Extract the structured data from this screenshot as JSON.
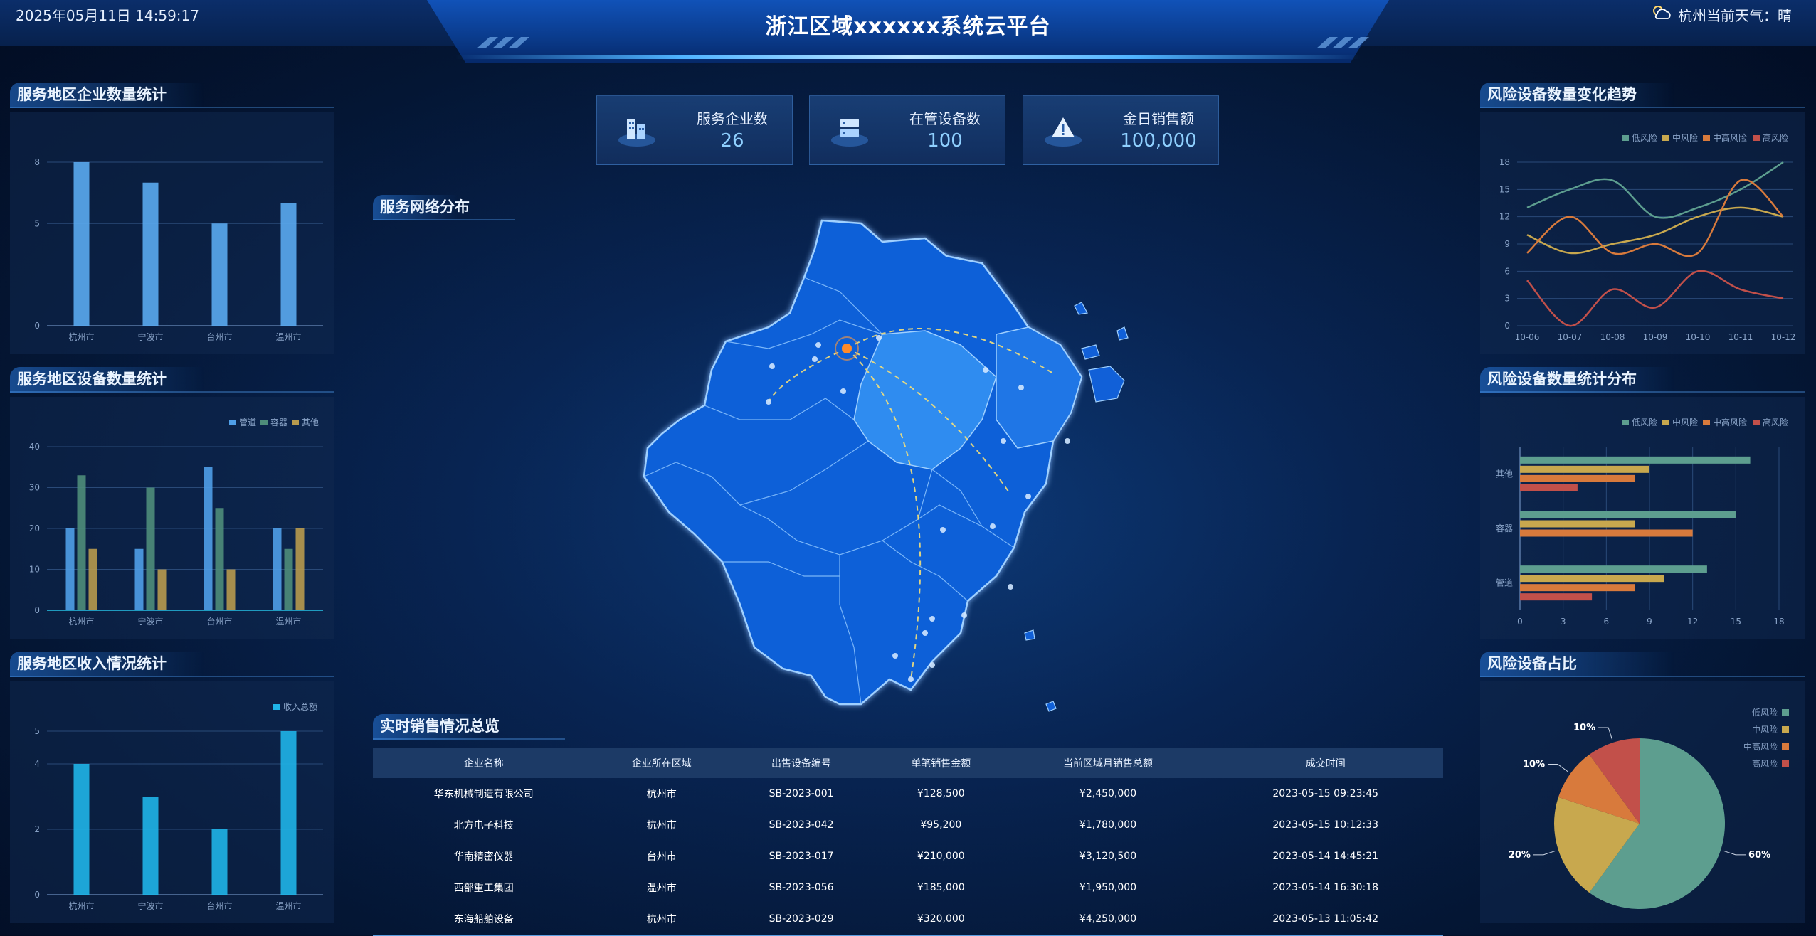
{
  "header": {
    "datetime": "2025年05月11日 14:59:17",
    "title": "浙江区域xxxxxx系统云平台",
    "weather": "杭州当前天气：晴",
    "weather_icon": "partly-cloudy-icon"
  },
  "stats": [
    {
      "label": "服务企业数",
      "value": "26",
      "icon": "enterprise-icon"
    },
    {
      "label": "在管设备数",
      "value": "100",
      "icon": "server-icon"
    },
    {
      "label": "金日销售额",
      "value": "100,000",
      "icon": "warning-icon"
    }
  ],
  "map": {
    "title": "服务网络分布"
  },
  "left": {
    "enterprise": {
      "title": "服务地区企业数量统计"
    },
    "devices": {
      "title": "服务地区设备数量统计"
    },
    "income": {
      "title": "服务地区收入情况统计"
    }
  },
  "right": {
    "trend": {
      "title": "风险设备数量变化趋势"
    },
    "dist": {
      "title": "风险设备数量统计分布"
    },
    "share": {
      "title": "风险设备占比"
    }
  },
  "sales": {
    "title": "实时销售情况总览",
    "columns": [
      "企业名称",
      "企业所在区域",
      "出售设备编号",
      "单笔销售金额",
      "当前区域月销售总额",
      "成交时间"
    ],
    "rows": [
      [
        "华东机械制造有限公司",
        "杭州市",
        "SB-2023-001",
        "¥128,500",
        "¥2,450,000",
        "2023-05-15 09:23:45"
      ],
      [
        "北方电子科技",
        "杭州市",
        "SB-2023-042",
        "¥95,200",
        "¥1,780,000",
        "2023-05-15 10:12:33"
      ],
      [
        "华南精密仪器",
        "台州市",
        "SB-2023-017",
        "¥210,000",
        "¥3,120,500",
        "2023-05-14 14:45:21"
      ],
      [
        "西部重工集团",
        "温州市",
        "SB-2023-056",
        "¥185,000",
        "¥1,950,000",
        "2023-05-14 16:30:18"
      ],
      [
        "东海船舶设备",
        "杭州市",
        "SB-2023-029",
        "¥320,000",
        "¥4,250,000",
        "2023-05-13 11:05:42"
      ]
    ]
  },
  "chart_data": [
    {
      "id": "enterprise",
      "type": "bar",
      "categories": [
        "杭州市",
        "宁波市",
        "台州市",
        "温州市"
      ],
      "values": [
        8,
        7,
        5,
        6
      ],
      "yticks": [
        "0",
        "5",
        "8"
      ],
      "ylim": [
        0,
        8
      ],
      "grid": true,
      "color": "#5aaaf0"
    },
    {
      "id": "devices",
      "type": "bar",
      "categories": [
        "杭州市",
        "宁波市",
        "台州市",
        "温州市"
      ],
      "series": [
        {
          "name": "管道",
          "values": [
            20,
            15,
            35,
            20
          ],
          "color": "#4f9fe8"
        },
        {
          "name": "容器",
          "values": [
            33,
            30,
            25,
            15
          ],
          "color": "#4e8d7a"
        },
        {
          "name": "其他",
          "values": [
            15,
            10,
            10,
            20
          ],
          "color": "#b79a4e"
        }
      ],
      "yticks": [
        "0",
        "10",
        "20",
        "30",
        "40"
      ],
      "ylim": [
        0,
        40
      ],
      "legend": "top-right",
      "grid": true
    },
    {
      "id": "income",
      "type": "bar",
      "categories": [
        "杭州市",
        "宁波市",
        "台州市",
        "温州市"
      ],
      "series": [
        {
          "name": "收入总额",
          "values": [
            4,
            3,
            2,
            5
          ],
          "color": "#1fb4e8"
        }
      ],
      "yticks": [
        "0",
        "2",
        "4",
        "5"
      ],
      "ylim": [
        0,
        5
      ],
      "legend": "top-right",
      "grid": true
    },
    {
      "id": "trend",
      "type": "line",
      "categories": [
        "10-06",
        "10-07",
        "10-08",
        "10-09",
        "10-10",
        "10-11",
        "10-12"
      ],
      "series": [
        {
          "name": "低风险",
          "values": [
            13,
            15,
            16,
            12,
            13,
            15,
            18
          ],
          "color": "#5d9e8f"
        },
        {
          "name": "中风险",
          "values": [
            10,
            8,
            9,
            10,
            12,
            13,
            12
          ],
          "color": "#c8a84e"
        },
        {
          "name": "中高风险",
          "values": [
            8,
            12,
            8,
            9,
            8,
            16,
            12
          ],
          "color": "#d87a3c"
        },
        {
          "name": "高风险",
          "values": [
            5,
            0,
            4,
            2,
            6,
            4,
            3
          ],
          "color": "#c2504a"
        }
      ],
      "yticks": [
        "0",
        "3",
        "6",
        "9",
        "12",
        "15",
        "18"
      ],
      "ylim": [
        0,
        18
      ],
      "legend": "top",
      "grid": true
    },
    {
      "id": "dist",
      "type": "bar",
      "orientation": "horizontal",
      "categories": [
        "管道",
        "容器",
        "其他"
      ],
      "series": [
        {
          "name": "低风险",
          "values": [
            13,
            15,
            16
          ],
          "color": "#5d9e8f"
        },
        {
          "name": "中风险",
          "values": [
            10,
            8,
            9
          ],
          "color": "#c8a84e"
        },
        {
          "name": "中高风险",
          "values": [
            8,
            12,
            8
          ],
          "color": "#d87a3c"
        },
        {
          "name": "高风险",
          "values": [
            5,
            0,
            4
          ],
          "color": "#c2504a"
        }
      ],
      "xticks": [
        "0",
        "3",
        "6",
        "9",
        "12",
        "15",
        "18"
      ],
      "xlim": [
        0,
        18
      ],
      "legend": "top",
      "grid": true
    },
    {
      "id": "share",
      "type": "pie",
      "slices": [
        {
          "name": "低风险",
          "value": 60,
          "label": "60%",
          "color": "#5d9e8f"
        },
        {
          "name": "中风险",
          "value": 20,
          "label": "20%",
          "color": "#c8a84e"
        },
        {
          "name": "中高风险",
          "value": 10,
          "label": "10%",
          "color": "#d87a3c"
        },
        {
          "name": "高风险",
          "value": 10,
          "label": "10%",
          "color": "#c2504a"
        }
      ],
      "legend": "top-right"
    }
  ]
}
